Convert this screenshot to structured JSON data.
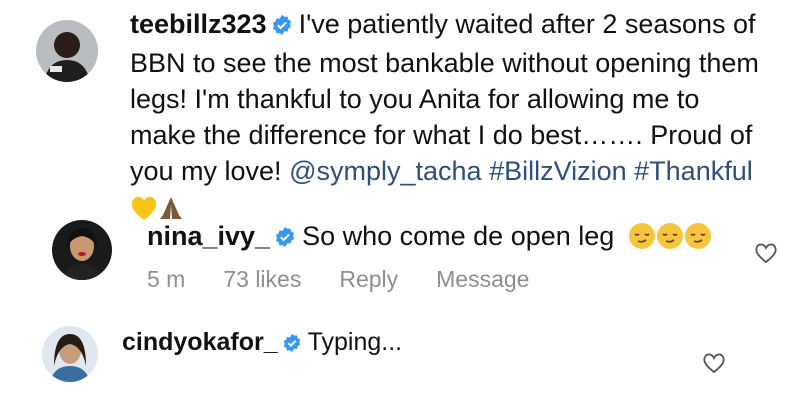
{
  "comments": [
    {
      "username": "teebillz323",
      "text_pre": "I've patiently waited after 2 seasons of BBN to see the most bankable without opening them legs! I'm thankful to you Anita for allowing me to make the difference for what I do best……. Proud of you my love!",
      "mention": "@symply_tacha",
      "hashtags": "#BillzVizion #Thankful",
      "emojis": [
        "yellow-heart",
        "folded-hands"
      ]
    },
    {
      "username": "nina_ivy_",
      "text": "So who come de open leg",
      "emojis": [
        "relieved-face",
        "relieved-face",
        "relieved-face"
      ],
      "meta": {
        "time": "5 m",
        "likes": "73 likes",
        "reply": "Reply",
        "message": "Message"
      }
    },
    {
      "username": "cindyokafor_",
      "text": "Typing..."
    }
  ],
  "colors": {
    "link": "#2c4f7c",
    "verified": "#3897f0",
    "meta": "#8e8e8e"
  }
}
